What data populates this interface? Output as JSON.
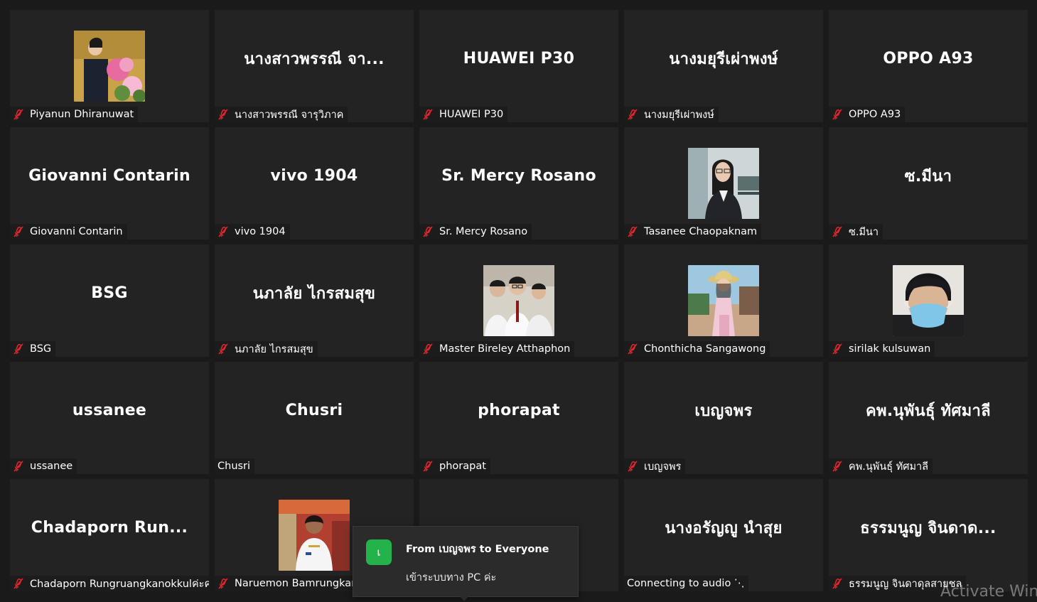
{
  "tiles": [
    {
      "big": "",
      "name": "Piyanun Dhiranuwat",
      "muted": true,
      "photo": "pink-bouquet"
    },
    {
      "big": "นางสาวพรรณี จา...",
      "name": "นางสาวพรรณี จารุวิภาค",
      "muted": true
    },
    {
      "big": "HUAWEI P30",
      "name": "HUAWEI P30",
      "muted": true
    },
    {
      "big": "นางมยุรีเผ่าพงษ์",
      "name": "นางมยุรีเผ่าพงษ์",
      "muted": true
    },
    {
      "big": "OPPO A93",
      "name": "OPPO A93",
      "muted": true
    },
    {
      "big": "Giovanni Contarin",
      "name": "Giovanni Contarin",
      "muted": true
    },
    {
      "big": "vivo 1904",
      "name": "vivo 1904",
      "muted": true
    },
    {
      "big": "Sr. Mercy Rosano",
      "name": "Sr. Mercy Rosano",
      "muted": true
    },
    {
      "big": "",
      "name": "Tasanee Chaopaknam",
      "muted": true,
      "photo": "woman-glasses"
    },
    {
      "big": "ซ.มีนา",
      "name": "ซ.มีนา",
      "muted": true
    },
    {
      "big": "BSG",
      "name": "BSG",
      "muted": true
    },
    {
      "big": "นภาลัย ไกรสมสุข",
      "name": "นภาลัย ไกรสมสุข",
      "muted": true
    },
    {
      "big": "",
      "name": "Master Bireley Atthaphon",
      "muted": true,
      "photo": "group-students"
    },
    {
      "big": "",
      "name": "Chonthicha Sangawong",
      "muted": true,
      "photo": "girl-outdoor"
    },
    {
      "big": "",
      "name": "sirilak kulsuwan",
      "muted": true,
      "photo": "boy-mask"
    },
    {
      "big": "ussanee",
      "name": "ussanee",
      "muted": true
    },
    {
      "big": "Chusri",
      "name": "Chusri",
      "muted": false
    },
    {
      "big": "phorapat",
      "name": "phorapat",
      "muted": true
    },
    {
      "big": "เบญจพร",
      "name": "เบญจพร",
      "muted": true
    },
    {
      "big": "คพ.นุพันธุ์ ทัศมาลี",
      "name": "คพ.นุพันธุ์ ทัศมาลี",
      "muted": true
    },
    {
      "big": "Chadaporn Run...",
      "name": "Chadaporn Rungruangkanokkulค่ะค",
      "muted": true
    },
    {
      "big": "",
      "name": "Naruemon Bamrungkar",
      "muted": true,
      "photo": "uniform-woman"
    },
    {
      "big": "",
      "name": "",
      "muted": false
    },
    {
      "big": "นางอรัญญู นำสุย",
      "name": "Connecting to audio ⋱",
      "muted": false
    },
    {
      "big": "ธรรมนูญ จินดาด...",
      "name": "ธรรมนูญ จินดาดุลสายชล",
      "muted": true
    }
  ],
  "chat_notification": {
    "avatar_letter": "เ",
    "from": "From เบญจพร to Everyone",
    "message": "เข้าระบบทาง PC ค่ะ"
  },
  "watermark": "Activate Win",
  "colors": {
    "mic_muted": "#e0272a",
    "tile_bg": "#232323",
    "avatar_bg": "#23b34a"
  }
}
